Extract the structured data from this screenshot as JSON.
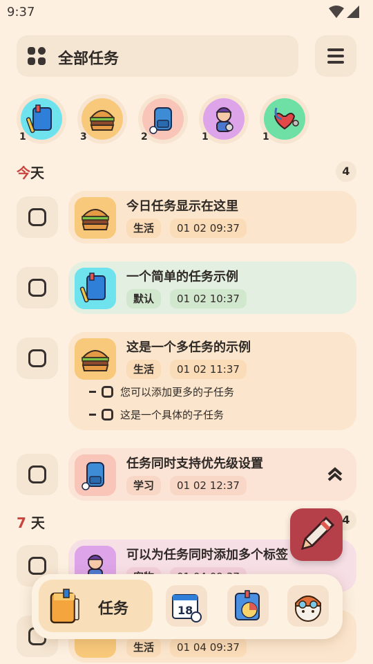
{
  "status": {
    "time": "9:37"
  },
  "header": {
    "title": "全部任务"
  },
  "categories": [
    {
      "icon": "notebook-icon",
      "count": "1",
      "bg": "#6ee3ee"
    },
    {
      "icon": "burger-icon",
      "count": "3",
      "bg": "#f8c97b"
    },
    {
      "icon": "backpack-icon",
      "count": "2",
      "bg": "#f9c5b8"
    },
    {
      "icon": "person-icon",
      "count": "1",
      "bg": "#dda4e9"
    },
    {
      "icon": "stethoscope-icon",
      "count": "1",
      "bg": "#6ee0a6"
    }
  ],
  "sections": [
    {
      "label_accent": "今",
      "label_rest": "天",
      "count": "4"
    },
    {
      "label_accent": "7",
      "label_rest": " 天",
      "count": "4"
    }
  ],
  "tasks": [
    {
      "title": "今日任务显示在这里",
      "tag": "生活",
      "time": "01 02 09:37",
      "card_bg": "#fbe6cd"
    },
    {
      "title": "一个简单的任务示例",
      "tag": "默认",
      "time": "01 02 10:37",
      "card_bg": "#e3efe0"
    },
    {
      "title": "这是一个多任务的示例",
      "tag": "生活",
      "time": "01 02 11:37",
      "card_bg": "#fbe6cd",
      "subtasks": [
        "您可以添加更多的子任务",
        "这是一个具体的子任务"
      ]
    },
    {
      "title": "任务同时支持优先级设置",
      "tag": "学习",
      "time": "01 02 12:37",
      "card_bg": "#fbe3d6"
    },
    {
      "title": "可以为任务同时添加多个标签",
      "tag": "宠物",
      "time": "01 04 09:37",
      "card_bg": "#f7dfe6"
    },
    {
      "title": "",
      "tag": "生活",
      "time": "01 04 09:37",
      "card_bg": "#fbe6cd"
    }
  ],
  "bottom_nav": {
    "active_label": "任务"
  },
  "colors": {
    "background": "#fdf0e0",
    "accent": "#c9443e",
    "fab": "#b6404a"
  }
}
